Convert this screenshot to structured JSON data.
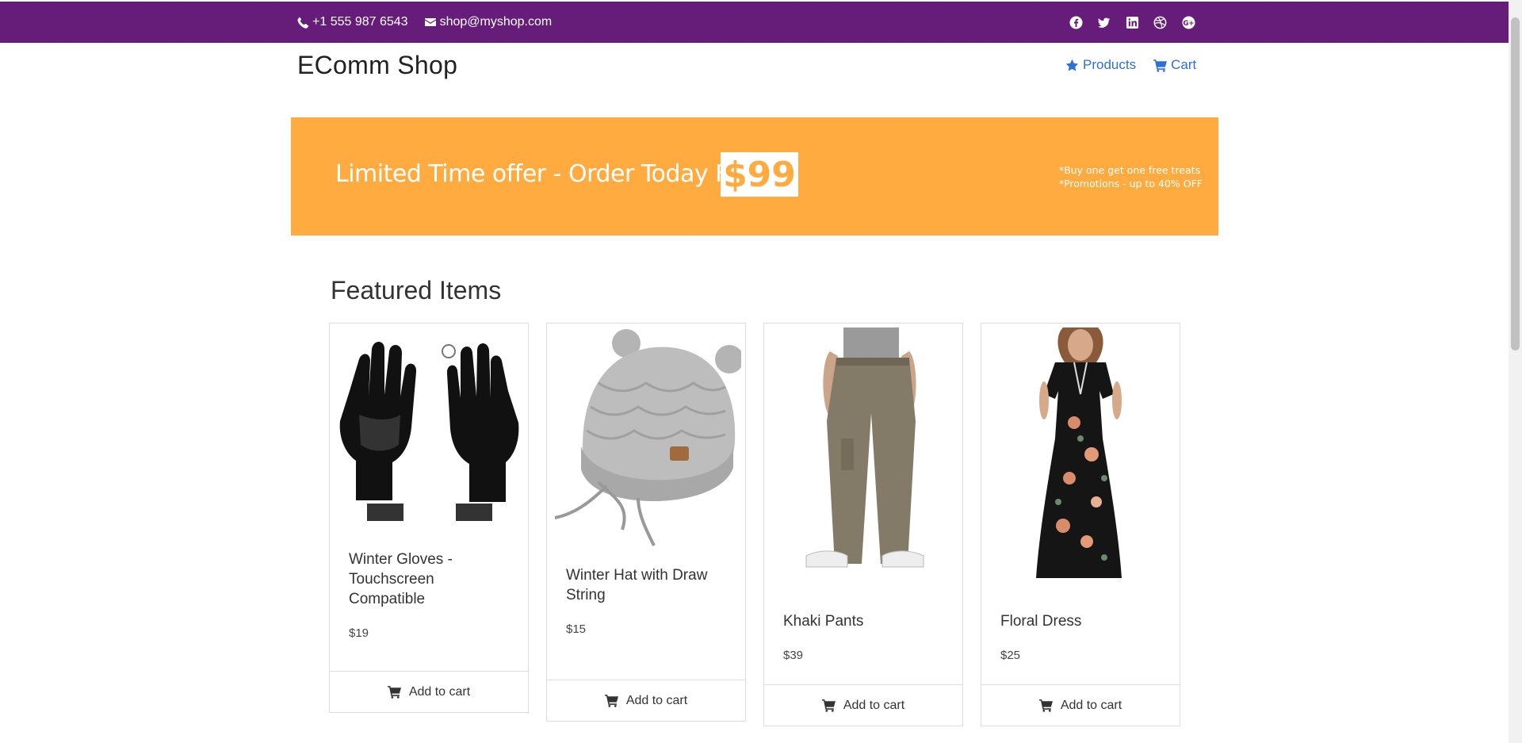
{
  "topbar": {
    "phone": "+1 555 987 6543",
    "email": "shop@myshop.com",
    "social_icons": [
      "facebook-icon",
      "twitter-icon",
      "linkedin-icon",
      "dribbble-icon",
      "google-plus-icon"
    ]
  },
  "navbar": {
    "brand": "EComm Shop",
    "links": [
      {
        "label": "Products",
        "icon": "star-icon"
      },
      {
        "label": "Cart",
        "icon": "cart-icon"
      }
    ]
  },
  "promo": {
    "headline": "Limited Time offer - Order Today For",
    "price": "$99",
    "note1": "*Buy one get one free treats",
    "note2": "*Promotions - up to 40% OFF"
  },
  "featured": {
    "title": "Featured Items",
    "products": [
      {
        "name": "Winter Gloves - Touchscreen Compatible",
        "price": "$19",
        "button": "Add to cart"
      },
      {
        "name": "Winter Hat with Draw String",
        "price": "$15",
        "button": "Add to cart"
      },
      {
        "name": "Khaki Pants",
        "price": "$39",
        "button": "Add to cart"
      },
      {
        "name": "Floral Dress",
        "price": "$25",
        "button": "Add to cart"
      }
    ]
  },
  "colors": {
    "topbar": "#661d79",
    "link": "#2f6fd6",
    "promo": "#ffab40"
  }
}
